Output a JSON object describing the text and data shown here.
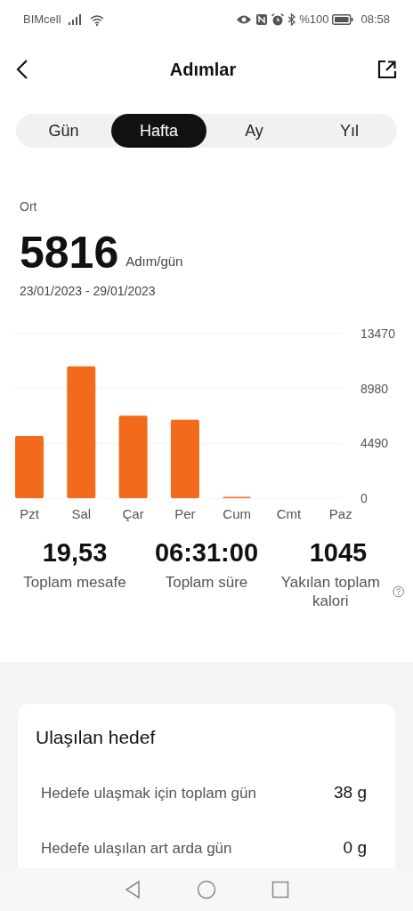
{
  "status_bar": {
    "carrier": "BIMcell",
    "battery_text": "%100",
    "time": "08:58"
  },
  "header": {
    "title": "Adımlar"
  },
  "tabs": [
    {
      "label": "Gün",
      "selected": false
    },
    {
      "label": "Hafta",
      "selected": true
    },
    {
      "label": "Ay",
      "selected": false
    },
    {
      "label": "Yıl",
      "selected": false
    }
  ],
  "summary": {
    "label": "Ort",
    "value": "5816",
    "unit": "Adım/gün",
    "date_range": "23/01/2023 - 29/01/2023"
  },
  "chart": {
    "chart_data": {
      "type": "bar",
      "categories": [
        "Pzt",
        "Sal",
        "Çar",
        "Per",
        "Cum",
        "Cmt",
        "Paz"
      ],
      "series": [
        {
          "color": "#f26b1d",
          "values": [
            5100,
            10800,
            6750,
            6430,
            30,
            null,
            null
          ]
        }
      ],
      "ylim": [
        0,
        13470
      ],
      "yticks": [
        0,
        4490,
        8980,
        13470
      ]
    }
  },
  "stats": [
    {
      "value": "19,53",
      "label": "Toplam mesafe"
    },
    {
      "value": "06:31:00",
      "label": "Toplam süre"
    },
    {
      "value": "1045",
      "label": "Yakılan toplam kalori"
    }
  ],
  "goal_card": {
    "title": "Ulaşılan hedef",
    "rows": [
      {
        "label": "Hedefe ulaşmak için toplam gün",
        "value": "38 g"
      },
      {
        "label": "Hedefe ulaşılan art arda gün",
        "value": "0 g"
      }
    ]
  }
}
